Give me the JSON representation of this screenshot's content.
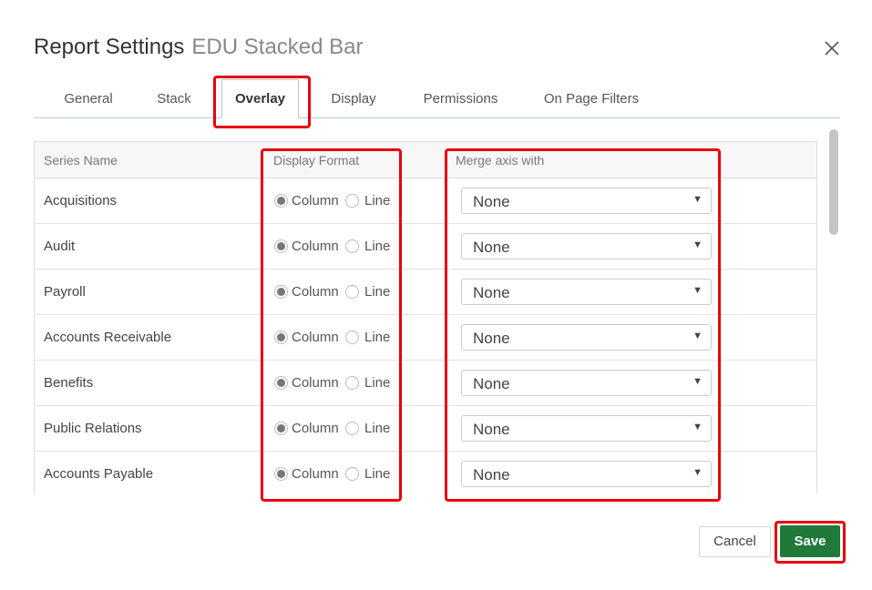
{
  "dialog": {
    "title": "Report Settings",
    "subtitle": "EDU Stacked Bar"
  },
  "tabs": [
    {
      "label": "General",
      "active": false
    },
    {
      "label": "Stack",
      "active": false
    },
    {
      "label": "Overlay",
      "active": true
    },
    {
      "label": "Display",
      "active": false
    },
    {
      "label": "Permissions",
      "active": false
    },
    {
      "label": "On Page Filters",
      "active": false
    }
  ],
  "table": {
    "headers": {
      "series_name": "Series Name",
      "display_format": "Display Format",
      "merge_axis": "Merge axis with"
    },
    "option_column": "Column",
    "option_line": "Line",
    "rows": [
      {
        "name": "Acquisitions",
        "format": "Column",
        "merge": "None"
      },
      {
        "name": "Audit",
        "format": "Column",
        "merge": "None"
      },
      {
        "name": "Payroll",
        "format": "Column",
        "merge": "None"
      },
      {
        "name": "Accounts Receivable",
        "format": "Column",
        "merge": "None"
      },
      {
        "name": "Benefits",
        "format": "Column",
        "merge": "None"
      },
      {
        "name": "Public Relations",
        "format": "Column",
        "merge": "None"
      },
      {
        "name": "Accounts Payable",
        "format": "Column",
        "merge": "None"
      }
    ]
  },
  "footer": {
    "cancel_label": "Cancel",
    "save_label": "Save"
  },
  "colors": {
    "accent_save": "#1f7a3a",
    "highlight": "#e8000b",
    "tab_border": "#b9cdd4"
  },
  "icons": {
    "close": "close-icon",
    "dropdown": "chevron-down-icon"
  }
}
